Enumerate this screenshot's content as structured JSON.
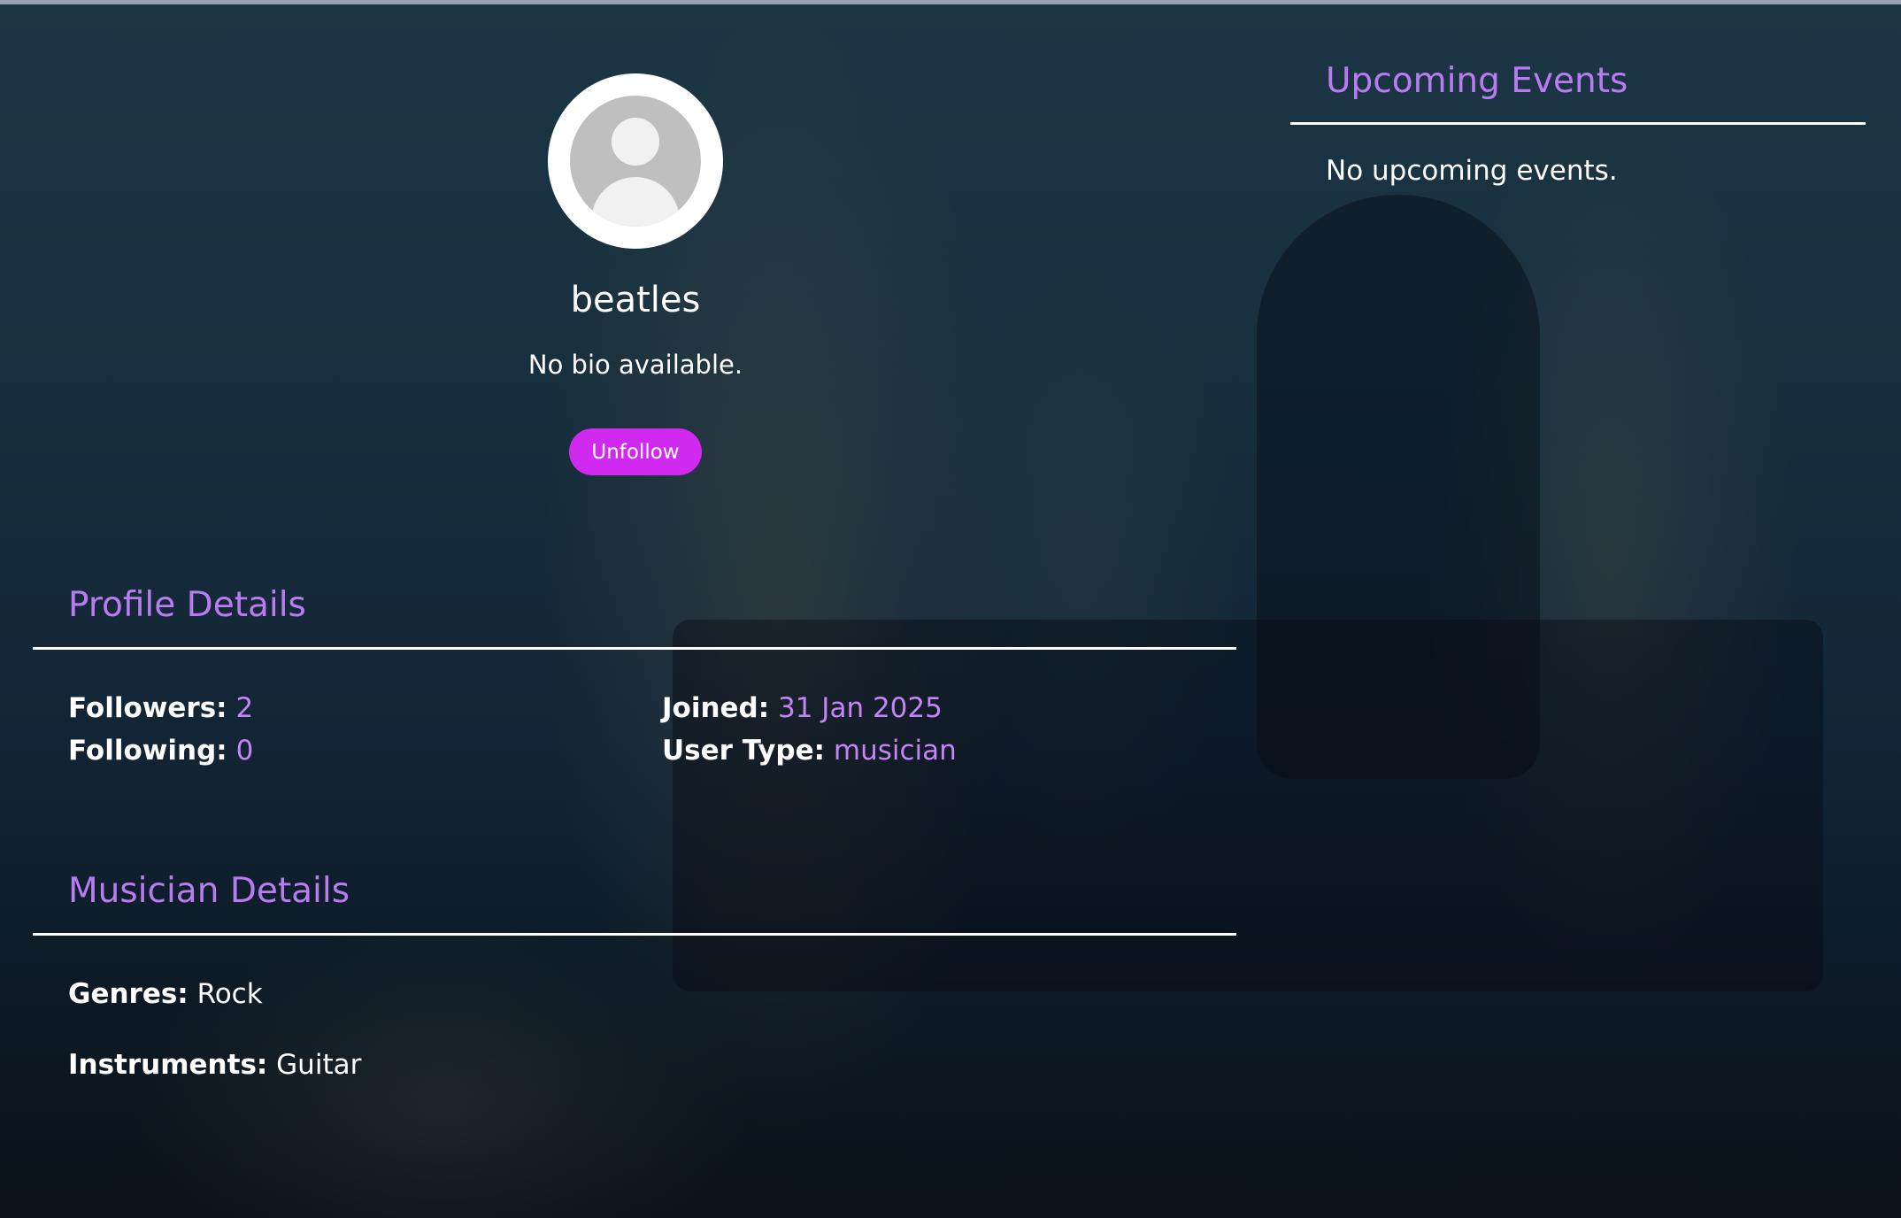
{
  "profile": {
    "username": "beatles",
    "bio": "No bio available.",
    "follow_button_label": "Unfollow"
  },
  "events": {
    "title": "Upcoming Events",
    "empty_message": "No upcoming events."
  },
  "profile_details": {
    "title": "Profile Details",
    "followers_label": "Followers:",
    "followers_value": "2",
    "following_label": "Following:",
    "following_value": "0",
    "joined_label": "Joined:",
    "joined_value": "31 Jan 2025",
    "user_type_label": "User Type:",
    "user_type_value": "musician"
  },
  "musician_details": {
    "title": "Musician Details",
    "genres_label": "Genres:",
    "genres_value": "Rock",
    "instruments_label": "Instruments:",
    "instruments_value": "Guitar"
  },
  "colors": {
    "accent": "#b97cf0",
    "button": "#d02af0",
    "background": "#152a39"
  },
  "icons": {
    "avatar": "default-user-avatar-icon"
  }
}
